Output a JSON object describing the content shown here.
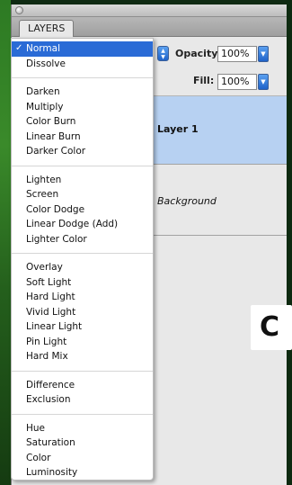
{
  "panel": {
    "tab_label": "LAYERS"
  },
  "blend_mode": {
    "selected": "Normal",
    "groups": [
      [
        "Normal",
        "Dissolve"
      ],
      [
        "Darken",
        "Multiply",
        "Color Burn",
        "Linear Burn",
        "Darker Color"
      ],
      [
        "Lighten",
        "Screen",
        "Color Dodge",
        "Linear Dodge (Add)",
        "Lighter Color"
      ],
      [
        "Overlay",
        "Soft Light",
        "Hard Light",
        "Vivid Light",
        "Linear Light",
        "Pin Light",
        "Hard Mix"
      ],
      [
        "Difference",
        "Exclusion"
      ],
      [
        "Hue",
        "Saturation",
        "Color",
        "Luminosity"
      ]
    ]
  },
  "opacity": {
    "label": "Opacity:",
    "value": "100%"
  },
  "fill": {
    "label": "Fill:",
    "value": "100%"
  },
  "layers": [
    {
      "name": "Layer 1",
      "selected": true
    },
    {
      "name": "Background",
      "selected": false
    }
  ],
  "callout": {
    "label": "C"
  },
  "icons": {
    "check": "✓",
    "blend_arrows": "up-down-arrows",
    "dropdown_arrow": "▼"
  },
  "colors": {
    "selection_blue": "#2a6bd6",
    "layer_highlight": "#b7d1f2"
  }
}
